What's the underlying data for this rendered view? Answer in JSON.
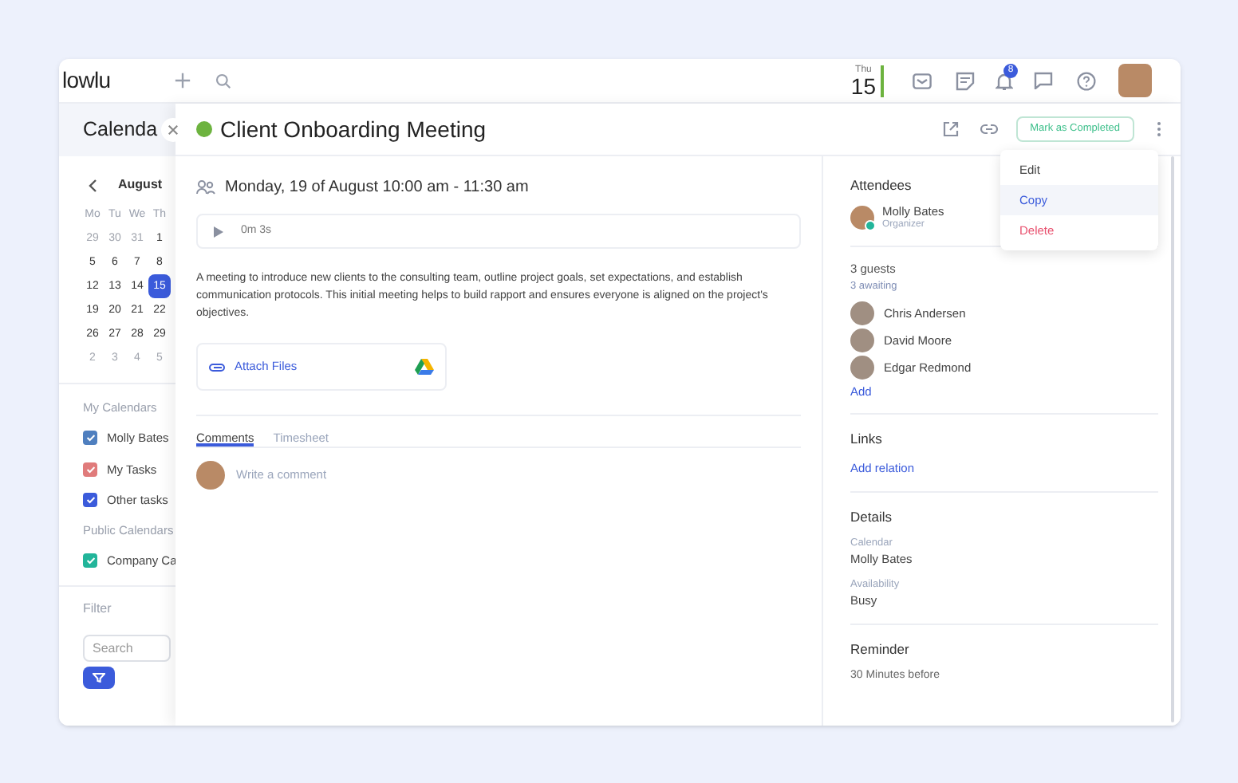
{
  "topbar": {
    "logo": "lowlu",
    "date": {
      "weekday": "Thu",
      "day": "15"
    },
    "notification_count": "8"
  },
  "sidebar": {
    "title": "Calenda",
    "month": "August",
    "weekdays": [
      "Mo",
      "Tu",
      "We",
      "Th"
    ],
    "weeks": [
      [
        {
          "day": "29",
          "muted": true,
          "selected": false
        },
        {
          "day": "30",
          "muted": true,
          "selected": false
        },
        {
          "day": "31",
          "muted": true,
          "selected": false
        },
        {
          "day": "1",
          "muted": false,
          "selected": false
        }
      ],
      [
        {
          "day": "5",
          "muted": false,
          "selected": false
        },
        {
          "day": "6",
          "muted": false,
          "selected": false
        },
        {
          "day": "7",
          "muted": false,
          "selected": false
        },
        {
          "day": "8",
          "muted": false,
          "selected": false
        }
      ],
      [
        {
          "day": "12",
          "muted": false,
          "selected": false
        },
        {
          "day": "13",
          "muted": false,
          "selected": false
        },
        {
          "day": "14",
          "muted": false,
          "selected": false
        },
        {
          "day": "15",
          "muted": false,
          "selected": true
        }
      ],
      [
        {
          "day": "19",
          "muted": false,
          "selected": false
        },
        {
          "day": "20",
          "muted": false,
          "selected": false
        },
        {
          "day": "21",
          "muted": false,
          "selected": false
        },
        {
          "day": "22",
          "muted": false,
          "selected": false
        }
      ],
      [
        {
          "day": "26",
          "muted": false,
          "selected": false
        },
        {
          "day": "27",
          "muted": false,
          "selected": false
        },
        {
          "day": "28",
          "muted": false,
          "selected": false
        },
        {
          "day": "29",
          "muted": false,
          "selected": false
        }
      ],
      [
        {
          "day": "2",
          "muted": true,
          "selected": false
        },
        {
          "day": "3",
          "muted": true,
          "selected": false
        },
        {
          "day": "4",
          "muted": true,
          "selected": false
        },
        {
          "day": "5",
          "muted": true,
          "selected": false
        }
      ]
    ],
    "my_calendars_label": "My Calendars",
    "my_calendars": [
      {
        "label": "Molly Bates",
        "color": "#4f7fbf",
        "checked": true
      },
      {
        "label": "My Tasks",
        "color": "#e07b7b",
        "checked": true
      },
      {
        "label": "Other tasks",
        "color": "#3b5bdb",
        "checked": true
      }
    ],
    "public_calendars_label": "Public Calendars",
    "public_calendars": [
      {
        "label": "Company Ca",
        "color": "#22b59a",
        "checked": true
      }
    ],
    "filter_label": "Filter",
    "search": {
      "placeholder": "Search"
    }
  },
  "event": {
    "title": "Client Onboarding Meeting",
    "complete_button": "Mark as Completed",
    "menu": [
      {
        "label": "Edit",
        "kind": "normal",
        "selected": false
      },
      {
        "label": "Copy",
        "kind": "normal",
        "selected": true
      },
      {
        "label": "Delete",
        "kind": "danger",
        "selected": false
      }
    ],
    "when": "Monday, 19 of August 10:00 am - 11:30 am",
    "duration": "0m 3s",
    "description": "A meeting to introduce new clients to the consulting team, outline project goals, set expectations, and establish communication protocols. This initial meeting helps to build rapport and ensures everyone is aligned on the project's objectives.",
    "attach_label": "Attach Files",
    "tabs": [
      {
        "label": "Comments",
        "selected": true
      },
      {
        "label": "Timesheet",
        "selected": false
      }
    ],
    "comment_placeholder": "Write a comment",
    "attendees": {
      "heading": "Attendees",
      "organizer": {
        "name": "Molly Bates",
        "role": "Organizer",
        "accepted": true
      },
      "guests_count": "3 guests",
      "awaiting": "3 awaiting",
      "guests": [
        "Chris Andersen",
        "David Moore",
        "Edgar Redmond"
      ],
      "add_label": "Add"
    },
    "links": {
      "heading": "Links",
      "add_label": "Add relation"
    },
    "details": {
      "heading": "Details",
      "fields": [
        {
          "label": "Calendar",
          "value": "Molly Bates"
        },
        {
          "label": "Availability",
          "value": "Busy"
        }
      ]
    },
    "reminder": {
      "heading": "Reminder",
      "value": "30 Minutes before"
    }
  }
}
